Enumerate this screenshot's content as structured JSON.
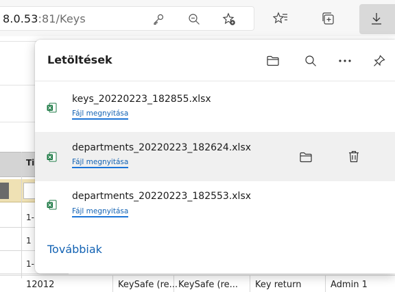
{
  "browser": {
    "url_prefix": "8.0.53",
    "url_rest": ":81/Keys",
    "icons": [
      "key-icon",
      "zoom-out-icon",
      "favorite-add-icon",
      "favorites-icon",
      "collections-icon",
      "download-icon"
    ]
  },
  "page": {
    "table_header_fragment": "Ti",
    "cells": [
      "1-",
      "1",
      "1-"
    ],
    "bottom_row": [
      "12012",
      "KeySafe (re...",
      "KeySafe (re...",
      "Key return",
      "Admin 1"
    ]
  },
  "downloads": {
    "title": "Letöltések",
    "header_icons": [
      "folder-icon",
      "search-icon",
      "more-icon",
      "pin-icon"
    ],
    "items": [
      {
        "filename": "keys_20220223_182855.xlsx",
        "action": "Fájl megnyitása"
      },
      {
        "filename": "departments_20220223_182624.xlsx",
        "action": "Fájl megnyitása"
      },
      {
        "filename": "departments_20220223_182553.xlsx",
        "action": "Fájl megnyitása"
      }
    ],
    "more_label": "Továbbiak"
  },
  "colors": {
    "link": "#1262b3",
    "excel_green": "#1d7a45",
    "hover_row": "#f0f0f0"
  }
}
